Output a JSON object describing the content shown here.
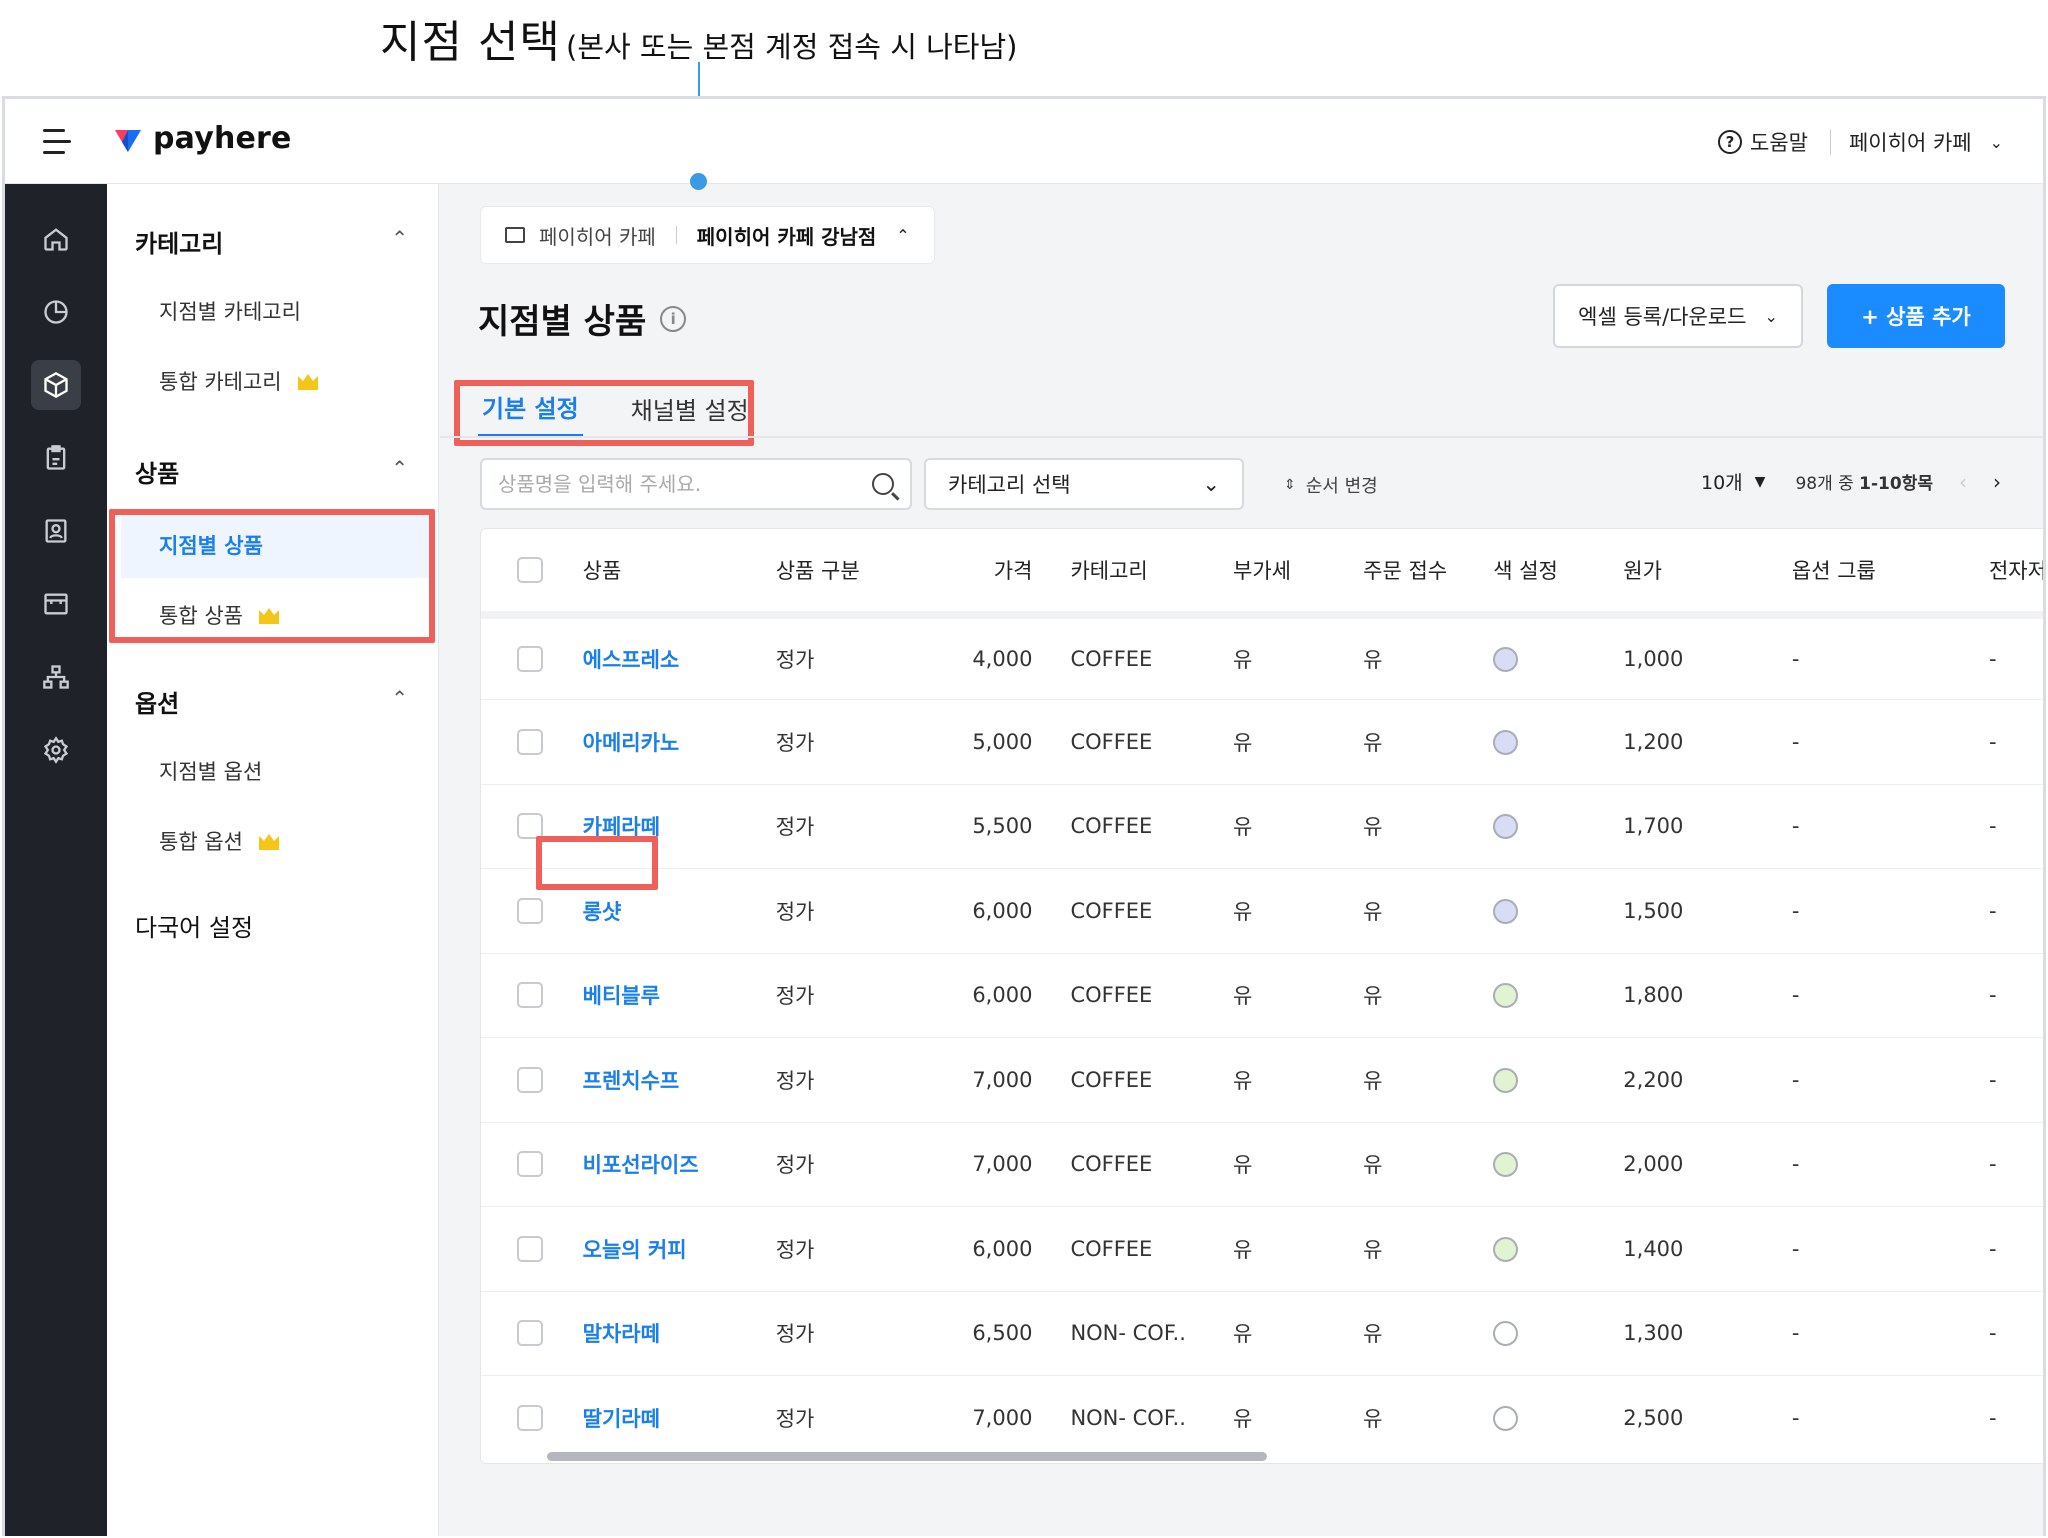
{
  "annotation": {
    "title": "지점 선택",
    "subtitle": "(본사 또는 본점 계정 접속 시 나타남)"
  },
  "topbar": {
    "logo_text": "payhere",
    "help_label": "도움말",
    "store_name": "페이히어 카페"
  },
  "rail": {
    "items": [
      "home-icon",
      "chart-icon",
      "product-box-icon",
      "clipboard-icon",
      "contact-card-icon",
      "store-icon",
      "org-chart-icon",
      "settings-icon"
    ],
    "active_index": 2
  },
  "subnav": {
    "groups": [
      {
        "label": "카테고리",
        "items": [
          {
            "label": "지점별 카테고리"
          },
          {
            "label": "통합 카테고리",
            "premium": true
          }
        ]
      },
      {
        "label": "상품",
        "items": [
          {
            "label": "지점별 상품",
            "active": true
          },
          {
            "label": "통합 상품",
            "premium": true
          }
        ]
      },
      {
        "label": "옵션",
        "items": [
          {
            "label": "지점별 옵션"
          },
          {
            "label": "통합 옵션",
            "premium": true
          }
        ]
      },
      {
        "label": "다국어 설정",
        "items": []
      }
    ],
    "accent_color": "#1a7fea",
    "premium_color": "#f5c518"
  },
  "breadcrumb": {
    "parent": "페이히어 카페",
    "current": "페이히어 카페 강남점"
  },
  "page": {
    "title": "지점별 상품",
    "excel_button": "엑셀 등록/다운로드",
    "add_button": "+ 상품 추가",
    "tabs": [
      {
        "label": "기본 설정",
        "active": true
      },
      {
        "label": "채널별 설정",
        "active": false
      }
    ]
  },
  "toolbar": {
    "search_placeholder": "상품명을 입력해 주세요.",
    "category_select": "카테고리 선택",
    "sort_label": "순서 변경",
    "page_size": "10개",
    "summary_prefix": "98개 중 ",
    "summary_range": "1-10항목"
  },
  "table": {
    "columns": [
      "상품",
      "상품 구분",
      "가격",
      "카테고리",
      "부가세",
      "주문 접수",
      "색 설정",
      "원가",
      "옵션 그룹",
      "전자저울"
    ],
    "rows": [
      {
        "name": "에스프레소",
        "type": "정가",
        "price": "4,000",
        "category": "COFFEE",
        "vat": "유",
        "order": "유",
        "color": "#d9dcf5",
        "cost": "1,000",
        "option_group": "-",
        "scale": "-"
      },
      {
        "name": "아메리카노",
        "type": "정가",
        "price": "5,000",
        "category": "COFFEE",
        "vat": "유",
        "order": "유",
        "color": "#d9dcf5",
        "cost": "1,200",
        "option_group": "-",
        "scale": "-"
      },
      {
        "name": "카페라떼",
        "type": "정가",
        "price": "5,500",
        "category": "COFFEE",
        "vat": "유",
        "order": "유",
        "color": "#d9dcf5",
        "cost": "1,700",
        "option_group": "-",
        "scale": "-"
      },
      {
        "name": "롱샷",
        "type": "정가",
        "price": "6,000",
        "category": "COFFEE",
        "vat": "유",
        "order": "유",
        "color": "#d9dcf5",
        "cost": "1,500",
        "option_group": "-",
        "scale": "-"
      },
      {
        "name": "베티블루",
        "type": "정가",
        "price": "6,000",
        "category": "COFFEE",
        "vat": "유",
        "order": "유",
        "color": "#e2f3d2",
        "cost": "1,800",
        "option_group": "-",
        "scale": "-"
      },
      {
        "name": "프렌치수프",
        "type": "정가",
        "price": "7,000",
        "category": "COFFEE",
        "vat": "유",
        "order": "유",
        "color": "#e2f3d2",
        "cost": "2,200",
        "option_group": "-",
        "scale": "-"
      },
      {
        "name": "비포선라이즈",
        "type": "정가",
        "price": "7,000",
        "category": "COFFEE",
        "vat": "유",
        "order": "유",
        "color": "#e2f3d2",
        "cost": "2,000",
        "option_group": "-",
        "scale": "-"
      },
      {
        "name": "오늘의 커피",
        "type": "정가",
        "price": "6,000",
        "category": "COFFEE",
        "vat": "유",
        "order": "유",
        "color": "#e2f3d2",
        "cost": "1,400",
        "option_group": "-",
        "scale": "-"
      },
      {
        "name": "말차라떼",
        "type": "정가",
        "price": "6,500",
        "category": "NON- COF..",
        "vat": "유",
        "order": "유",
        "color": "#ffffff",
        "cost": "1,300",
        "option_group": "-",
        "scale": "-"
      },
      {
        "name": "딸기라떼",
        "type": "정가",
        "price": "7,000",
        "category": "NON- COF..",
        "vat": "유",
        "order": "유",
        "color": "#ffffff",
        "cost": "2,500",
        "option_group": "-",
        "scale": "-"
      }
    ]
  },
  "highlight_color": "#f0605a"
}
